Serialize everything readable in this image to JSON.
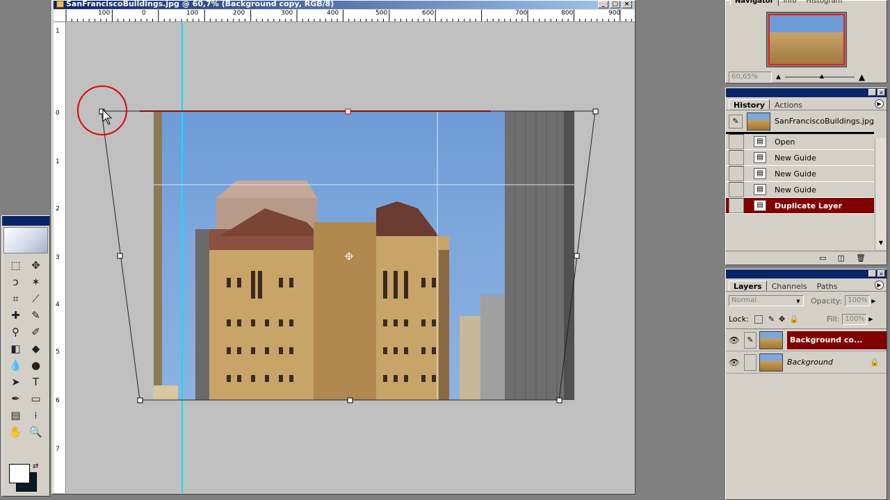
{
  "document": {
    "title": "SanFranciscoBuildings.jpg @ 60,7% (Background copy, RGB/8)",
    "ruler_h_labels": [
      "100",
      "0",
      "100",
      "200",
      "300",
      "400",
      "500",
      "600",
      "700",
      "800",
      "900"
    ],
    "ruler_v_labels": [
      "1",
      "0",
      "1",
      "2",
      "3",
      "4",
      "5",
      "6",
      "7"
    ],
    "window_buttons": [
      "_",
      "□",
      "×"
    ]
  },
  "navigator": {
    "tabs": [
      "Navigator",
      "Info",
      "Histogram"
    ],
    "zoom": "60,65%"
  },
  "history": {
    "tabs": [
      "History",
      "Actions"
    ],
    "snapshot": "SanFranciscoBuildings.jpg",
    "items": [
      {
        "label": "Open"
      },
      {
        "label": "New Guide"
      },
      {
        "label": "New Guide"
      },
      {
        "label": "New Guide"
      },
      {
        "label": "Duplicate Layer"
      }
    ]
  },
  "layers": {
    "tabs": [
      "Layers",
      "Channels",
      "Paths"
    ],
    "blend_mode": "Normal",
    "opacity_label": "Opacity:",
    "opacity": "100%",
    "lock_label": "Lock:",
    "fill_label": "Fill:",
    "fill": "100%",
    "items": [
      {
        "name": "Background co..."
      },
      {
        "name": "Background"
      }
    ]
  },
  "colors": {
    "accent": "#0a246a",
    "selection": "#800000",
    "guide": "#00e5ff",
    "transform_edge": "#e00000"
  }
}
